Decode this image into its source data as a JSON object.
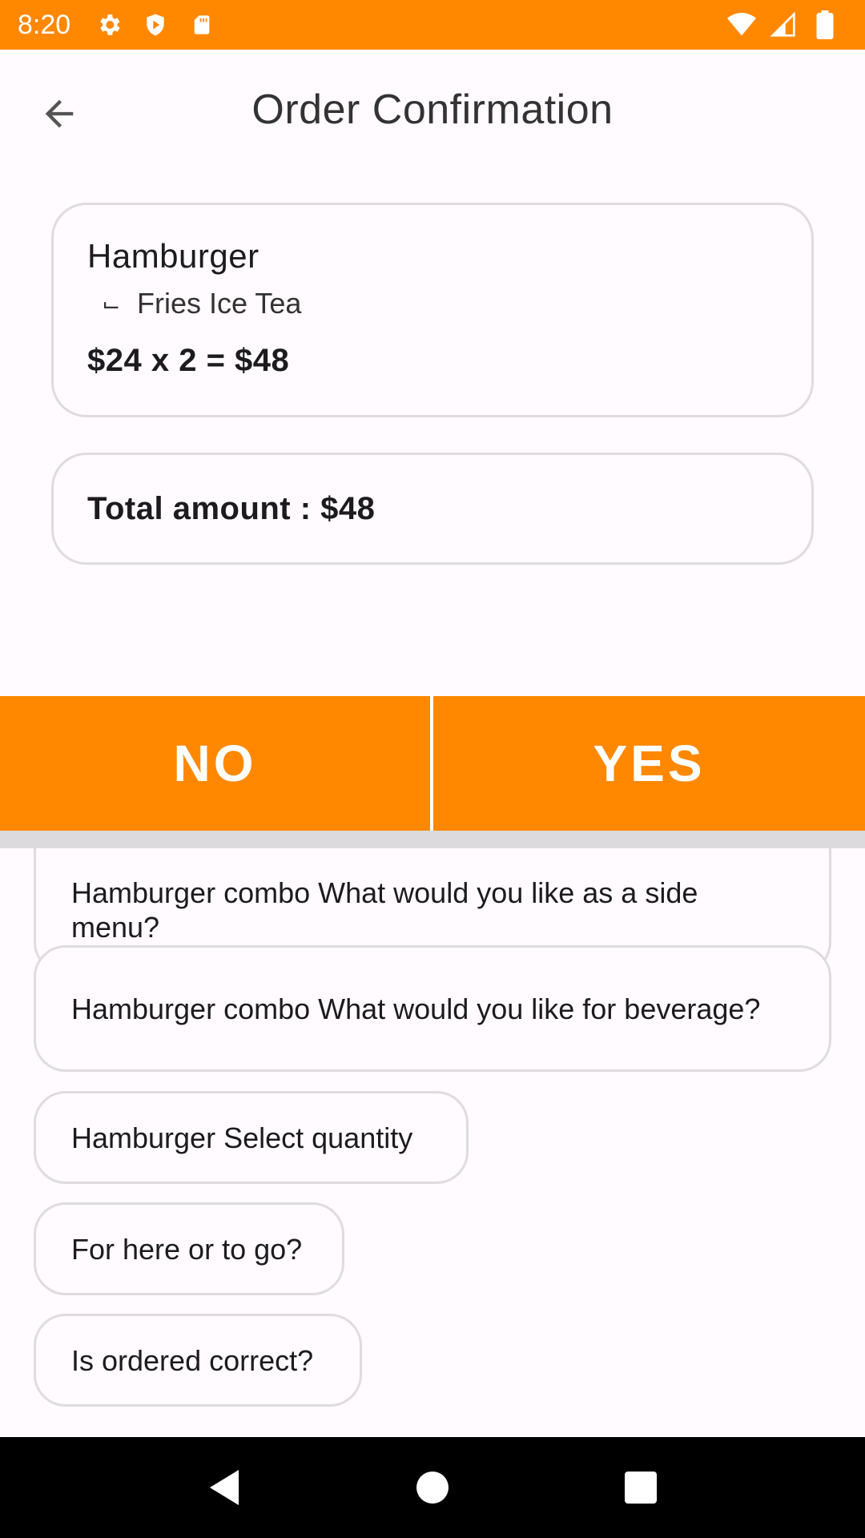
{
  "status_bar": {
    "time": "8:20",
    "left_icons": [
      "gear-icon",
      "shield-icon",
      "sd-card-icon"
    ],
    "right_icons": [
      "wifi-icon",
      "cell-signal-icon",
      "battery-icon"
    ],
    "color": "#ff8800"
  },
  "header": {
    "title": "Order Confirmation",
    "back_icon": "arrow-back-icon"
  },
  "order": {
    "item_name": "Hamburger",
    "corner_glyph": "⌙",
    "options": "Fries Ice Tea",
    "price_line": "$24 x 2 = $48"
  },
  "total": {
    "text": "Total amount : $48"
  },
  "actions": {
    "no_label": "NO",
    "yes_label": "YES",
    "accent": "#ff8800"
  },
  "chat": {
    "bubbles": [
      "Hamburger combo What would you like as a side menu?",
      "Hamburger combo What would you like for beverage?",
      "Hamburger Select quantity",
      "For here or to go?",
      "Is ordered correct?"
    ]
  },
  "nav_bar": {
    "icons": [
      "back-triangle-icon",
      "home-circle-icon",
      "recents-square-icon"
    ]
  }
}
